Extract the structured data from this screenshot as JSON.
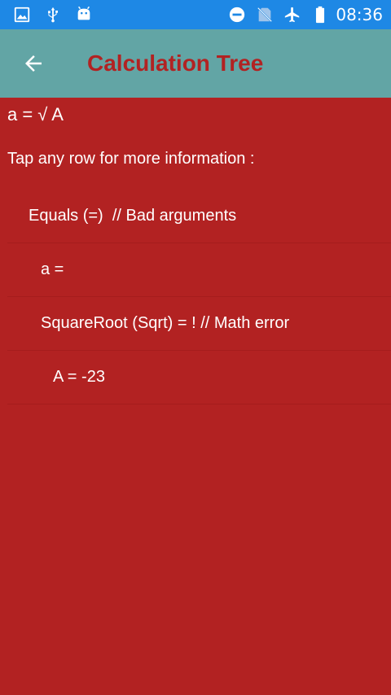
{
  "status_bar": {
    "time": "08:36",
    "background": "#1e88e5",
    "left_icons": [
      "image-icon",
      "usb-icon",
      "android-icon"
    ],
    "right_icons": [
      "do-not-disturb-icon",
      "no-sim-icon",
      "airplane-icon",
      "battery-icon"
    ]
  },
  "app_bar": {
    "title": "Calculation Tree",
    "background": "#62a5a5",
    "title_color": "#b22222"
  },
  "main": {
    "background": "#b22222",
    "expression": "a = √ A",
    "hint": "Tap any row for more information :",
    "rows": [
      {
        "text": "Equals (=)  // Bad arguments",
        "depth": 1
      },
      {
        "text": "a =",
        "depth": 2
      },
      {
        "text": "SquareRoot (Sqrt) = ! // Math error",
        "depth": 2
      },
      {
        "text": "A = -23",
        "depth": 3
      }
    ]
  }
}
